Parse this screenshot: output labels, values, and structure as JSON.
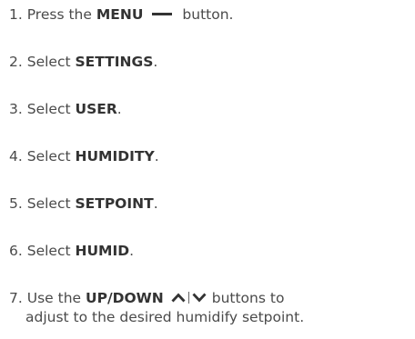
{
  "steps": [
    {
      "num": "1.",
      "pre": "Press the",
      "bold": "MENU",
      "post": "button."
    },
    {
      "num": "2.",
      "pre": "Select",
      "bold": "SETTINGS",
      "post": "."
    },
    {
      "num": "3.",
      "pre": "Select",
      "bold": "USER",
      "post": "."
    },
    {
      "num": "4.",
      "pre": "Select",
      "bold": "HUMIDITY",
      "post": "."
    },
    {
      "num": "5.",
      "pre": "Select",
      "bold": "SETPOINT",
      "post": "."
    },
    {
      "num": "6.",
      "pre": "Select",
      "bold": "HUMID",
      "post": "."
    },
    {
      "num": "7.",
      "pre": "Use the",
      "bold": "UP/DOWN",
      "post": "buttons to",
      "line2": "adjust to the desired humidify setpoint."
    }
  ],
  "icons": {
    "menu": "minus-icon",
    "up": "chevron-up-icon",
    "down": "chevron-down-icon"
  }
}
